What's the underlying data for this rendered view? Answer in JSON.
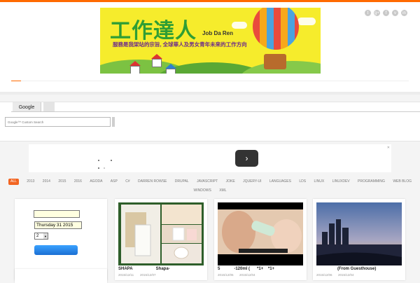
{
  "header": {
    "brand_title": "工作達人",
    "brand_en": "Job Da Ren",
    "slogan": "服務是我架站的宗旨, 全球華人及男女青年未來的工作方向",
    "social_icons": [
      "twitter-icon",
      "googleplus-icon",
      "facebook-icon",
      "vimeo-icon",
      "linkedin-icon"
    ],
    "social_glyphs": [
      "t",
      "g+",
      "f",
      "v",
      "in"
    ]
  },
  "colors": {
    "accent": "#ff6a00",
    "category_active": "#f26522",
    "banner_yellow": "#f6ec2c",
    "button_blue": "#1b6fd3"
  },
  "google_search": {
    "tab_label": "Google",
    "placeholder": "Google™ Custom Search"
  },
  "ad": {
    "next_symbol": "›"
  },
  "categories": [
    "ALL",
    "2013",
    "2014",
    "2015",
    "2016",
    "AGODA",
    "ASP",
    "C#",
    "DARREN ROWSE",
    "DRUPAL",
    "JAVASCRIPT",
    "JOKE",
    "JQUERY-UI",
    "LANGUAGES",
    "LDS",
    "LINUX",
    "LINUXDEV",
    "PROGRAMMING",
    "WEB BLOG",
    "WINDOWS",
    "XML"
  ],
  "sidebar": {
    "date_value": "Thursday 31  2015",
    "select_value": "2"
  },
  "posts": [
    {
      "title": "SHAPA                    Shapa-",
      "date_left": "2015/12/11",
      "date_right": "2015/12/07"
    },
    {
      "title": "5            -120ml (      *1+    *1+",
      "date_left": "2015/12/05",
      "date_right": "2015/12/04"
    },
    {
      "title": "                  (From Guesthouse)",
      "date_left": "2015/12/06",
      "date_right": "2015/12/04"
    }
  ]
}
